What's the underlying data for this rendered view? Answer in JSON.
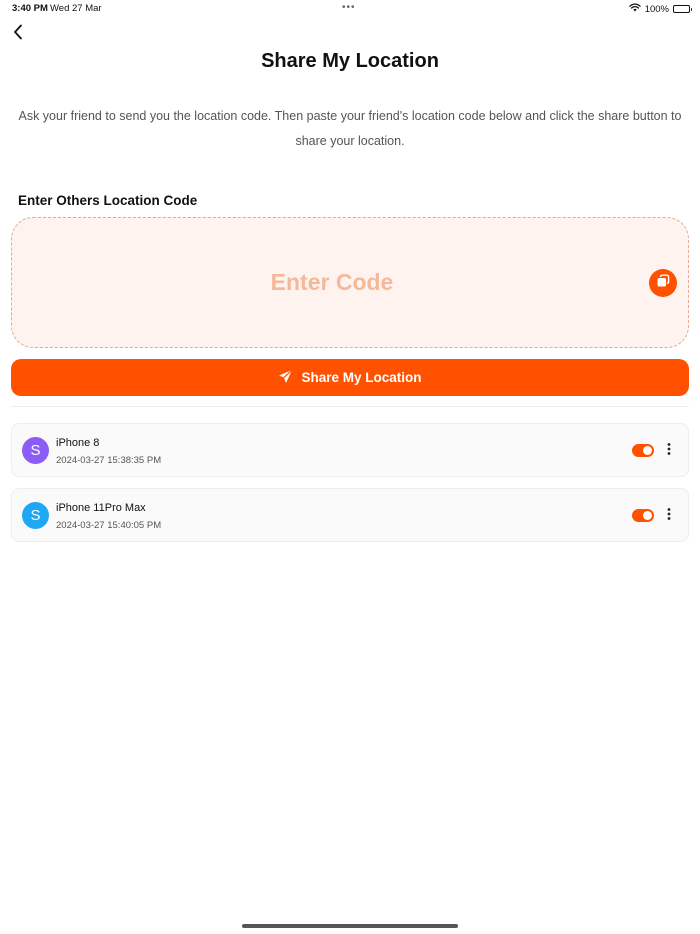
{
  "status_bar": {
    "time": "3:40 PM",
    "date": "Wed 27 Mar",
    "dots": "•••",
    "battery_text": "100%"
  },
  "header": {
    "back_icon": "chevron-left-icon",
    "title": "Share My Location"
  },
  "instructions": "Ask your friend to send you the location code. Then paste your friend's location code below and click the share button to share your location.",
  "code_section": {
    "label": "Enter Others Location Code",
    "placeholder": "Enter Code",
    "paste_icon": "copy-icon"
  },
  "share_button": {
    "label": "Share My Location",
    "icon": "send-icon"
  },
  "devices": [
    {
      "avatar_letter": "S",
      "avatar_color": "#8b5cf6",
      "name": "iPhone 8",
      "timestamp": "2024-03-27 15:38:35 PM",
      "enabled": true
    },
    {
      "avatar_letter": "S",
      "avatar_color": "#1ea7f2",
      "name": "iPhone 11Pro Max",
      "timestamp": "2024-03-27 15:40:05 PM",
      "enabled": true
    }
  ],
  "colors": {
    "accent": "#ff5100",
    "code_box_bg": "#fff3ef",
    "placeholder": "#f6b89a"
  }
}
